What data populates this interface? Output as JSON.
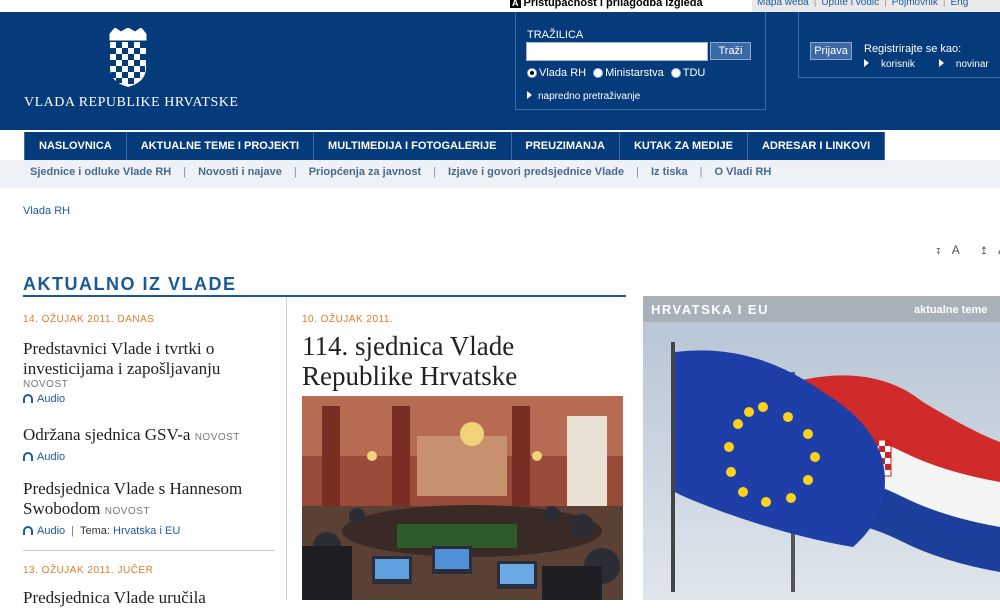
{
  "utility": {
    "accessibility_icon": "A",
    "accessibility": "Pristupačnost i prilagodba izgleda",
    "links": [
      "Mapa weba",
      "Upute i vodič",
      "Pojmovnik",
      "Eng"
    ]
  },
  "header": {
    "brand": "VLADA REPUBLIKE HRVATSKE",
    "search": {
      "label": "TRAŽILICA",
      "value": "",
      "button": "Traži",
      "options": [
        "Vlada RH",
        "Ministarstva",
        "TDU"
      ],
      "selected": "Vlada RH",
      "advanced": "napredno pretraživanje"
    },
    "login": {
      "button": "Prijava",
      "register": "Registrirajte se kao:",
      "options": [
        "korisnik",
        "novinar"
      ]
    }
  },
  "nav": {
    "items": [
      "NASLOVNICA",
      "AKTUALNE TEME I PROJEKTI",
      "MULTIMEDIJA I FOTOGALERIJE",
      "PREUZIMANJA",
      "KUTAK ZA MEDIJE",
      "ADRESAR I LINKOVI"
    ]
  },
  "subnav": {
    "items": [
      "Sjednice i odluke Vlade RH",
      "Novosti i najave",
      "Priopćenja za javnost",
      "Izjave i govori predsjednice Vlade",
      "Iz tiska",
      "O Vladi RH"
    ]
  },
  "breadcrumb": "Vlada RH",
  "text_size": {
    "smaller": "A",
    "larger": "A"
  },
  "section_title": "AKTUALNO IZ VLADE",
  "news": {
    "date1": "14. OŽUJAK 2011. DANAS",
    "items": [
      {
        "title": "Predstavnici Vlade i tvrtki o investicijama i zapošljavanju",
        "badge": "NOVOST",
        "audio": "Audio"
      },
      {
        "title": "Održana sjednica GSV-a",
        "badge": "NOVOST",
        "audio": "Audio"
      },
      {
        "title": "Predsjednica Vlade s Hannesom Swobodom",
        "badge": "NOVOST",
        "audio": "Audio",
        "tema_label": "Tema:",
        "tema": "Hrvatska i EU"
      }
    ],
    "date2": "13. OŽUJAK 2011. JUČER",
    "next_title": "Predsjednica Vlade uručila"
  },
  "feature": {
    "date": "10. OŽUJAK 2011.",
    "title": "114. sjednica Vlade Republike Hrvatske"
  },
  "right_panel": {
    "title": "HRVATSKA I EU",
    "link": "aktualne teme"
  }
}
